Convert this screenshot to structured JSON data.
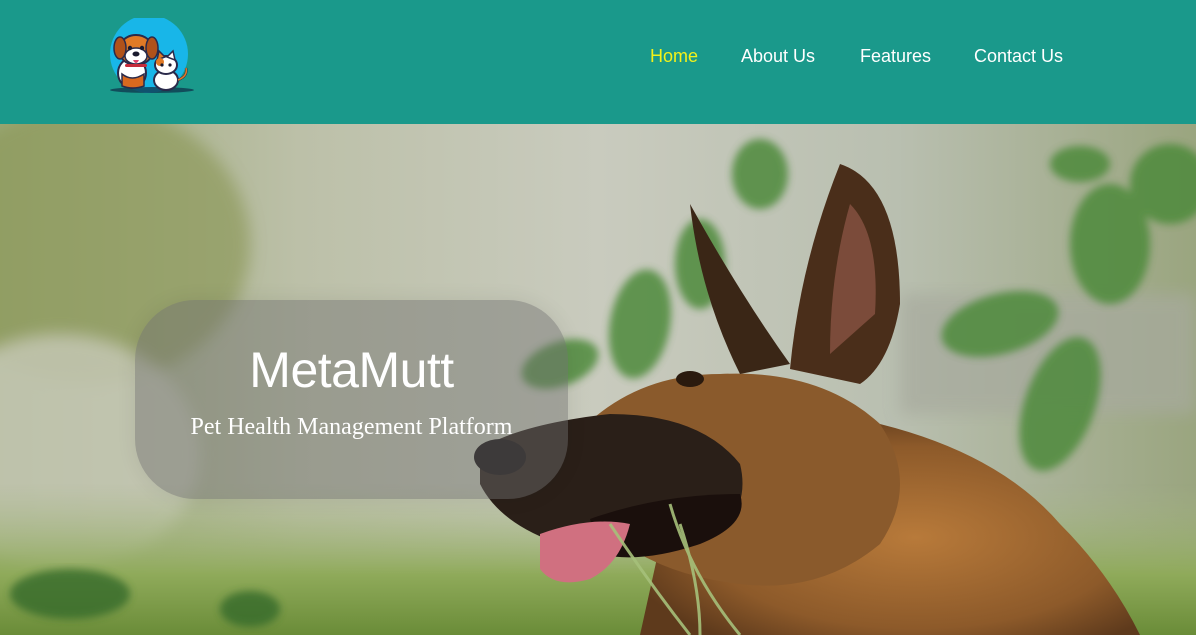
{
  "header": {
    "background_color": "#1a998b",
    "logo_icon": "dog-and-cat-logo-icon",
    "nav": {
      "items": [
        {
          "label": "Home",
          "active": true
        },
        {
          "label": "About Us",
          "active": false
        },
        {
          "label": "Features",
          "active": false
        },
        {
          "label": "Contact Us",
          "active": false
        }
      ],
      "active_color": "#f2f21a",
      "text_color": "#ffffff"
    }
  },
  "hero": {
    "image": "german-shepherd-dog-photo",
    "title": "MetaMutt",
    "subtitle": "Pet Health Management Platform"
  }
}
